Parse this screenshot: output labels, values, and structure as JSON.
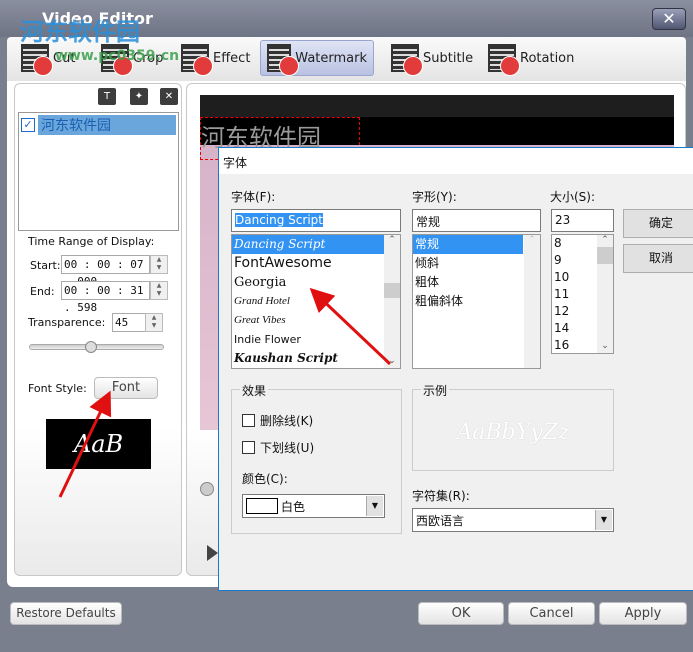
{
  "window": {
    "title": "Video Editor",
    "close": "✕"
  },
  "watermark": {
    "site": "河东软件园",
    "url": "www.pc0359.cn"
  },
  "tabs": [
    {
      "label": "Cut"
    },
    {
      "label": "Crop"
    },
    {
      "label": "Effect"
    },
    {
      "label": "Watermark",
      "selected": true
    },
    {
      "label": "Subtitle"
    },
    {
      "label": "Rotation"
    }
  ],
  "left": {
    "icons": [
      "add-text-icon",
      "add-image-icon",
      "delete-icon"
    ],
    "watermark_items": [
      {
        "label": "河东软件园",
        "checked": true
      }
    ],
    "time_range_label": "Time Range of Display:",
    "start_label": "Start:",
    "start_value": "00 : 00 : 07 . 000",
    "end_label": "End:",
    "end_value": "00 : 00 : 31 . 598",
    "transparence_label": "Transparence:",
    "transparence_value": "45",
    "transparence_percent": 45,
    "font_style_label": "Font Style:",
    "font_button": "Font",
    "preview_text": "AaB"
  },
  "video": {
    "watermark_text": "河东软件园"
  },
  "font_dialog": {
    "title": "字体",
    "font_label": "字体(F):",
    "font_value": "Dancing Script",
    "fonts": [
      "Dancing Script",
      "FontAwesome",
      "Georgia",
      "Grand Hotel",
      "Great Vibes",
      "Indie Flower",
      "Kaushan Script"
    ],
    "style_label": "字形(Y):",
    "style_value": "常规",
    "styles": [
      "常规",
      "倾斜",
      "粗体",
      "粗偏斜体"
    ],
    "size_label": "大小(S):",
    "size_value": "23",
    "sizes": [
      "8",
      "9",
      "10",
      "11",
      "12",
      "14",
      "16"
    ],
    "ok": "确定",
    "cancel": "取消",
    "effects_label": "效果",
    "strike_label": "删除线(K)",
    "underline_label": "下划线(U)",
    "color_label": "颜色(C):",
    "color_value": "白色",
    "sample_label": "示例",
    "sample_text": "AaBbYyZz",
    "charset_label": "字符集(R):",
    "charset_value": "西欧语言"
  },
  "footer": {
    "restore": "Restore Defaults",
    "ok": "OK",
    "cancel": "Cancel",
    "apply": "Apply"
  }
}
